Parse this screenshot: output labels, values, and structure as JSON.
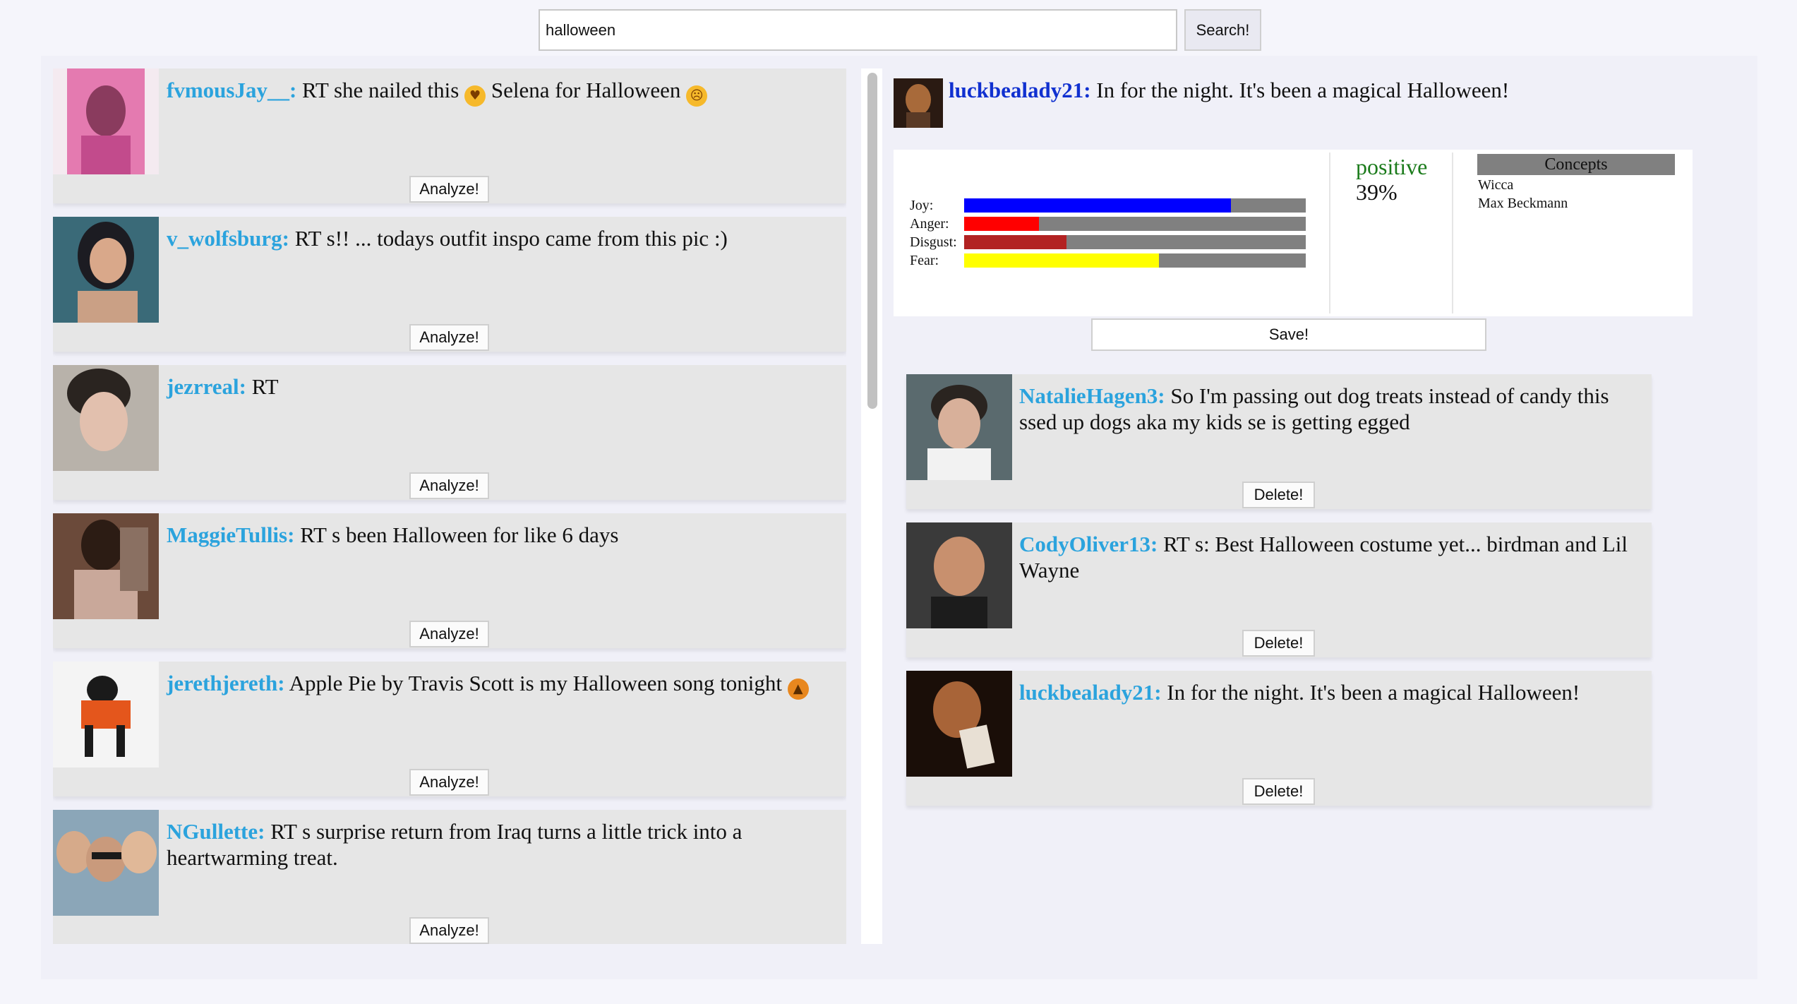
{
  "search": {
    "value": "halloween",
    "button_label": "Search!"
  },
  "feed": {
    "tweets": [
      {
        "username": "fvmousJay__:",
        "text": "RT she nailed this",
        "text_after": "Selena for Halloween",
        "analyze_label": "Analyze!"
      },
      {
        "username": "v_wolfsburg:",
        "text": "RT s!! ... todays outfit inspo came from this pic :)",
        "analyze_label": "Analyze!"
      },
      {
        "username": "jezrreal:",
        "text": "RT",
        "analyze_label": "Analyze!"
      },
      {
        "username": "MaggieTullis:",
        "text": "RT s been Halloween for like 6 days",
        "analyze_label": "Analyze!"
      },
      {
        "username": "jerethjereth:",
        "text": "Apple Pie by Travis Scott is my Halloween song tonight",
        "analyze_label": "Analyze!"
      },
      {
        "username": "NGullette:",
        "text": "RT s surprise return from Iraq turns a little trick into a heartwarming treat.",
        "analyze_label": "Analyze!"
      }
    ]
  },
  "selected": {
    "username": "luckbealady21:",
    "text": "In for the night. It's been a magical Halloween!"
  },
  "analysis": {
    "emotions": [
      {
        "label": "Joy:",
        "value": 0.78,
        "color": "#0000ff"
      },
      {
        "label": "Anger:",
        "value": 0.22,
        "color": "#ff0000"
      },
      {
        "label": "Disgust:",
        "value": 0.3,
        "color": "#b22222"
      },
      {
        "label": "Fear:",
        "value": 0.57,
        "color": "#ffff00"
      }
    ],
    "sentiment_label": "positive",
    "sentiment_score": "39%",
    "concepts_header": "Concepts",
    "concepts": [
      "Wicca",
      "Max Beckmann"
    ],
    "save_label": "Save!"
  },
  "saved": {
    "tweets": [
      {
        "username": "NatalieHagen3:",
        "text": "So I'm passing out dog treats instead of candy this ssed up dogs aka my kids se is getting egged",
        "delete_label": "Delete!"
      },
      {
        "username": "CodyOliver13:",
        "text": "RT s: Best Halloween costume yet... birdman and Lil Wayne",
        "delete_label": "Delete!"
      },
      {
        "username": "luckbealady21:",
        "text": "In for the night. It's been a magical Halloween!",
        "delete_label": "Delete!"
      }
    ]
  },
  "colors": {
    "username": "#2ba3dd",
    "selected_username": "#1030d0",
    "positive": "#1b7b1b",
    "card_bg": "#e6e6e6"
  }
}
